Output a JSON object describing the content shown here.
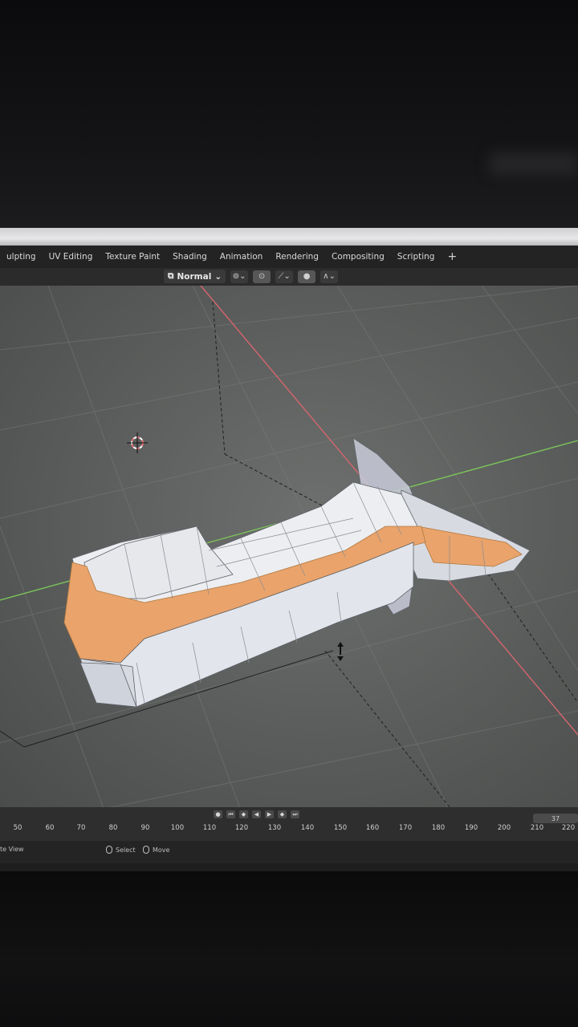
{
  "workspace_tabs": [
    "ulpting",
    "UV Editing",
    "Texture Paint",
    "Shading",
    "Animation",
    "Rendering",
    "Compositing",
    "Scripting"
  ],
  "add_tab_label": "+",
  "header": {
    "orientation_label": "Normal",
    "icons": [
      "transform-orientation-icon",
      "pivot-icon",
      "snap-icon",
      "proportional-edit-icon",
      "falloff-icon"
    ]
  },
  "timeline": {
    "current_frame": "37",
    "ticks": [
      "50",
      "60",
      "70",
      "80",
      "90",
      "100",
      "110",
      "120",
      "130",
      "140",
      "150",
      "160",
      "170",
      "180",
      "190",
      "200",
      "210",
      "220"
    ]
  },
  "status_bar": {
    "left": "te View",
    "select_label": "Select",
    "move_label": "Move"
  },
  "colors": {
    "selection": "#e9a36b",
    "x_axis": "#d6656d",
    "y_axis": "#7cc45a",
    "mesh_light": "#e6e8ee"
  }
}
